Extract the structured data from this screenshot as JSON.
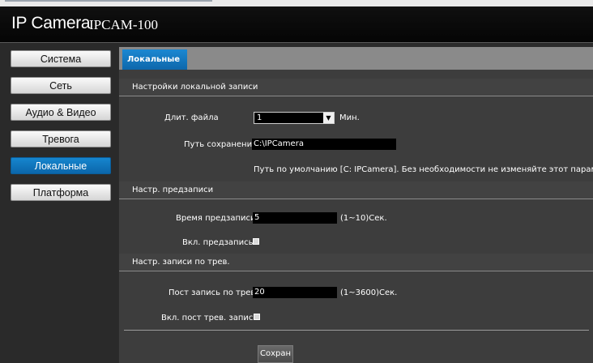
{
  "header": {
    "brand": "IP Camera",
    "model": "IPCAM-100"
  },
  "sidebar": {
    "items": [
      {
        "label": "Система"
      },
      {
        "label": "Сеть"
      },
      {
        "label": "Аудио & Видео"
      },
      {
        "label": "Тревога"
      },
      {
        "label": "Локальные",
        "active": true
      },
      {
        "label": "Платформа"
      }
    ]
  },
  "tabs": [
    {
      "label": "Локальные"
    }
  ],
  "sections": {
    "local": "Настройки локальной записи",
    "prerecord": "Настр. предзаписи",
    "alarm": "Настр. записи по трев."
  },
  "form": {
    "file_length": {
      "label": "Длит. файла",
      "value": "1",
      "unit": "Мин."
    },
    "save_path": {
      "label": "Путь сохранения:",
      "value": "C:\\IPCamera"
    },
    "path_hint": "Путь по умолчанию [C: IPCamera]. Без необходимости не изменяйте этот параметр.",
    "prerecord_time": {
      "label": "Время предзаписи:",
      "value": "5",
      "range": "(1~10)Сек."
    },
    "prerecord_enable": {
      "label": "Вкл. предзапись:"
    },
    "post_alarm_time": {
      "label": "Пост запись по трев.",
      "value": "20",
      "range": "(1~3600)Сек."
    },
    "post_alarm_enable": {
      "label": "Вкл. пост трев. запись"
    }
  },
  "buttons": {
    "save": "Сохран"
  }
}
